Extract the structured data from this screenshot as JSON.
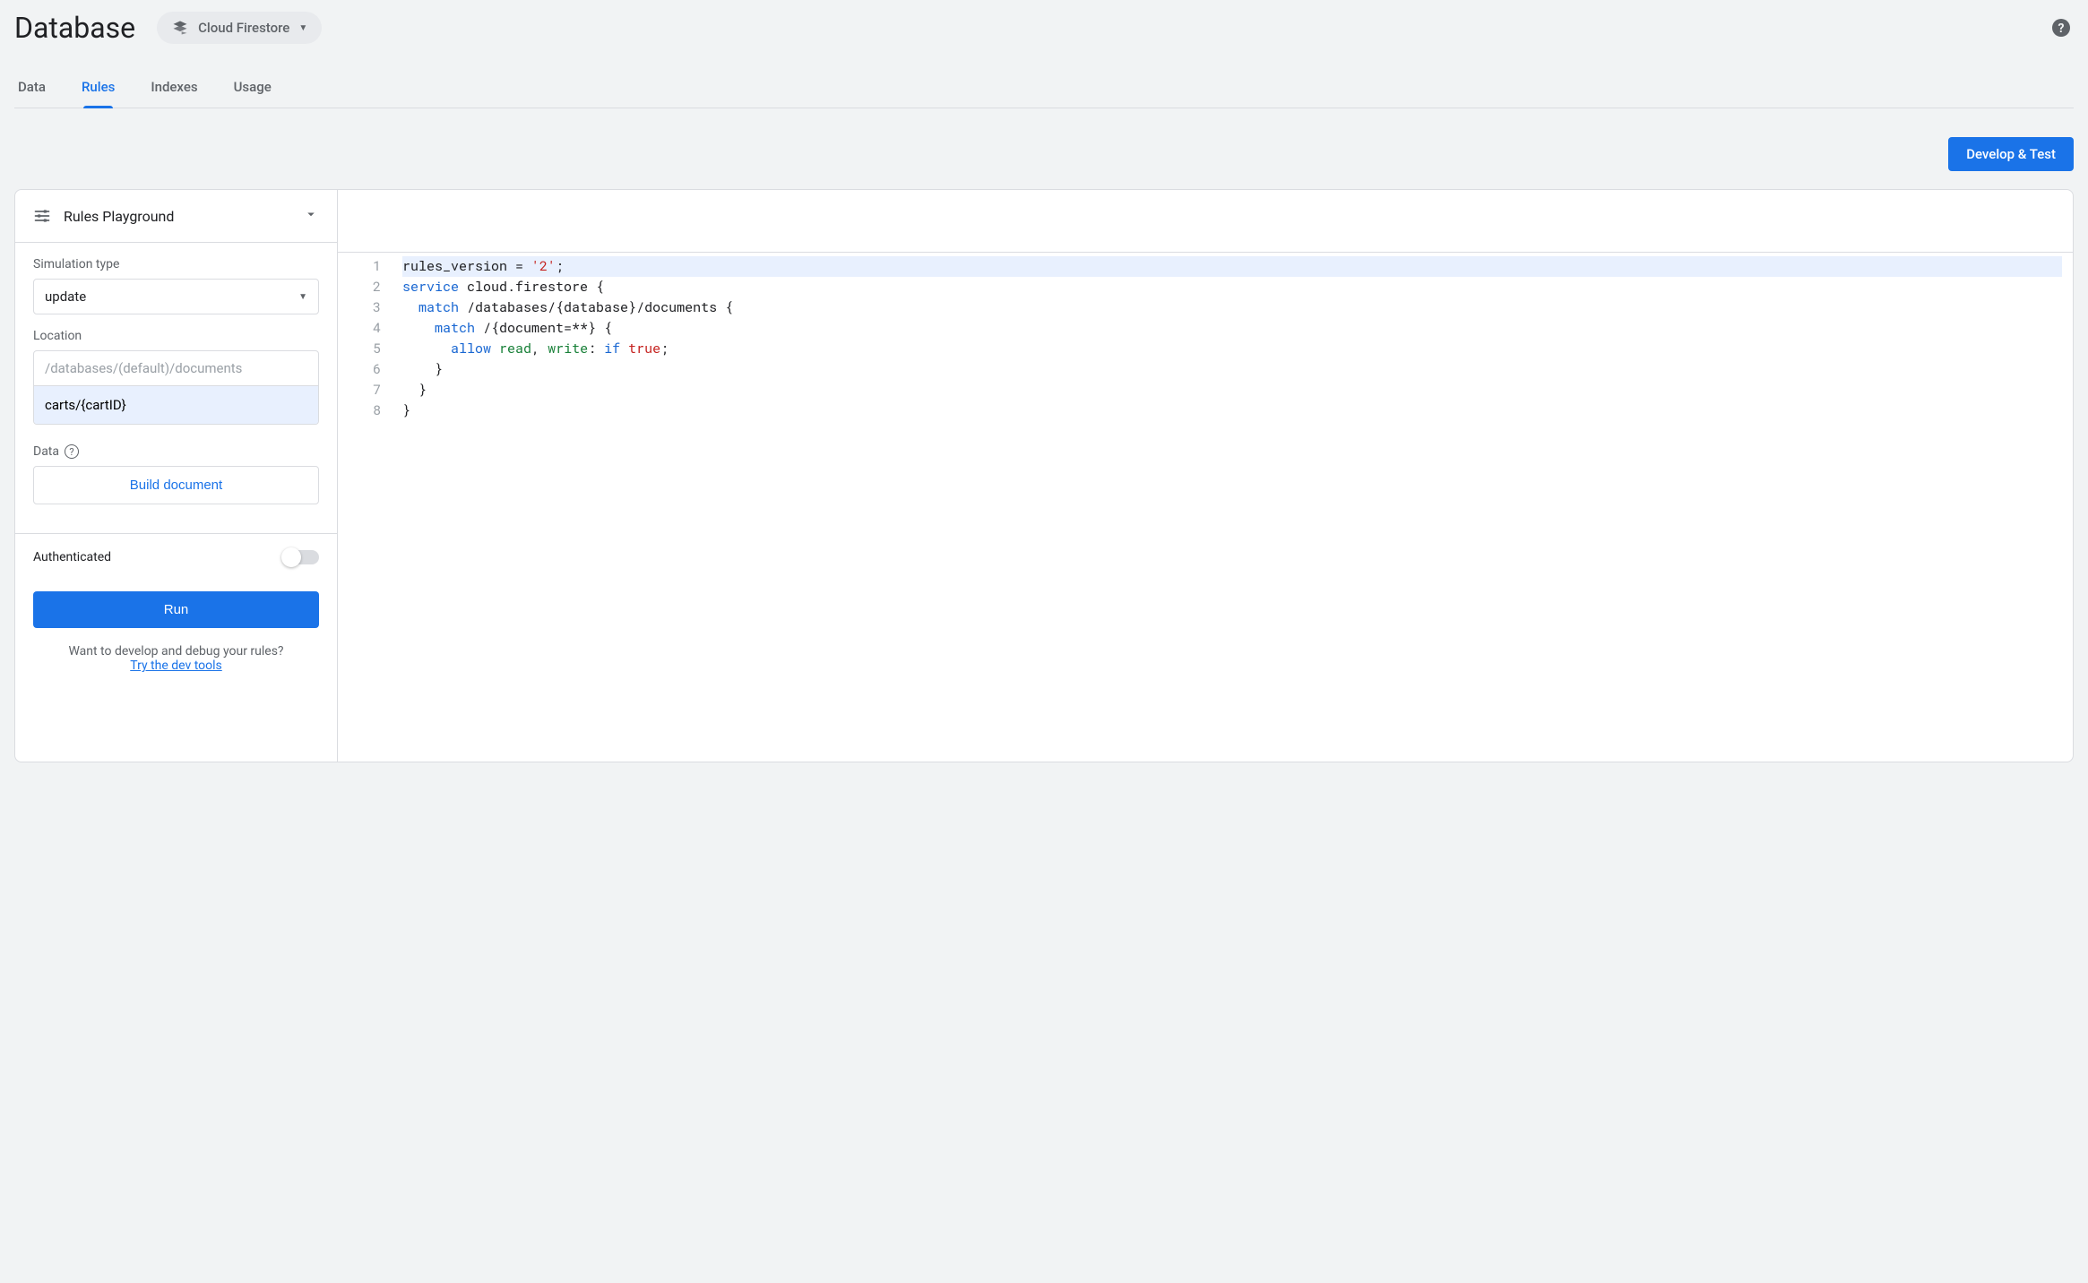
{
  "header": {
    "title": "Database",
    "product_chip_label": "Cloud Firestore"
  },
  "tabs": [
    {
      "id": "data",
      "label": "Data",
      "active": false
    },
    {
      "id": "rules",
      "label": "Rules",
      "active": true
    },
    {
      "id": "indexes",
      "label": "Indexes",
      "active": false
    },
    {
      "id": "usage",
      "label": "Usage",
      "active": false
    }
  ],
  "action_bar": {
    "develop_test_label": "Develop & Test"
  },
  "sidebar": {
    "header_title": "Rules Playground",
    "sim_type_label": "Simulation type",
    "sim_type_value": "update",
    "location_label": "Location",
    "location_prefix": "/databases/(default)/documents",
    "location_value": "carts/{cartID}",
    "data_label": "Data",
    "build_doc_label": "Build document",
    "auth_label": "Authenticated",
    "auth_on": false,
    "run_label": "Run",
    "dev_note": "Want to develop and debug your rules?",
    "dev_link": "Try the dev tools"
  },
  "editor": {
    "lines": [
      "rules_version = '2';",
      "service cloud.firestore {",
      "  match /databases/{database}/documents {",
      "    match /{document=**} {",
      "      allow read, write: if true;",
      "    }",
      "  }",
      "}"
    ]
  }
}
